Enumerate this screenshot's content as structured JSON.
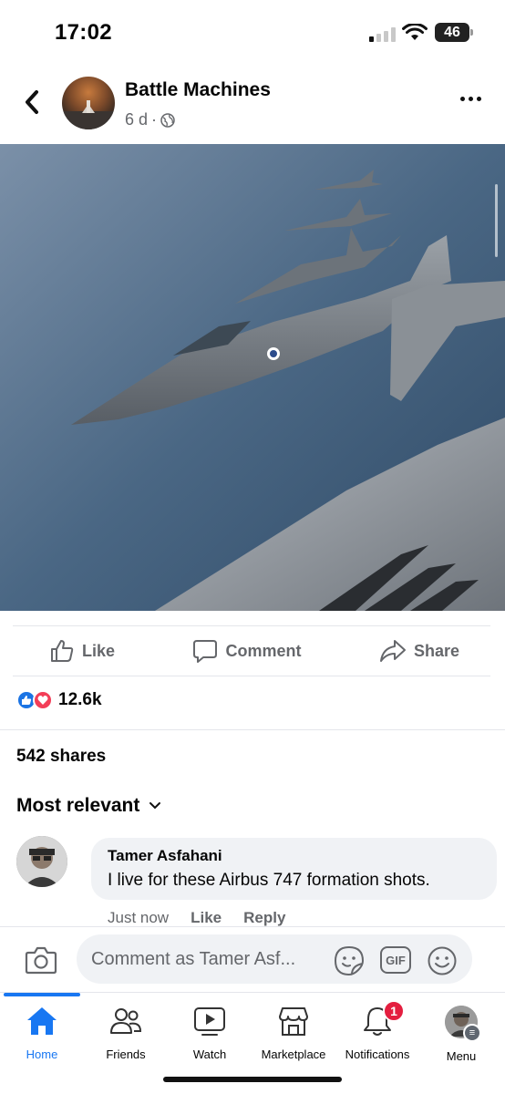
{
  "status_bar": {
    "time": "17:02",
    "battery": "46"
  },
  "header": {
    "page_name": "Battle Machines",
    "post_age": "6 d",
    "separator": "·"
  },
  "actions": {
    "like": "Like",
    "comment": "Comment",
    "share": "Share"
  },
  "reactions": {
    "count": "12.6k"
  },
  "shares": "542 shares",
  "sort_label": "Most relevant",
  "comment": {
    "author": "Tamer Asfahani",
    "text": "I live for these Airbus 747 formation shots.",
    "time": "Just now",
    "like": "Like",
    "reply": "Reply"
  },
  "composer": {
    "placeholder": "Comment as Tamer Asf...",
    "gif_label": "GIF"
  },
  "tabs": [
    {
      "label": "Home"
    },
    {
      "label": "Friends"
    },
    {
      "label": "Watch"
    },
    {
      "label": "Marketplace"
    },
    {
      "label": "Notifications",
      "badge": "1"
    },
    {
      "label": "Menu"
    }
  ],
  "colors": {
    "accent": "#1877f2",
    "like_blue": "#1b74e4",
    "love_red": "#f33e58",
    "badge_red": "#e41e3f",
    "muted": "#65676b",
    "bubble": "#f0f2f5"
  },
  "icons": [
    "back-icon",
    "globe-icon",
    "more-icon",
    "like-icon",
    "comment-icon",
    "share-icon",
    "camera-icon",
    "sticker-icon",
    "emoji-icon",
    "home-icon",
    "friends-icon",
    "watch-icon",
    "marketplace-icon",
    "bell-icon",
    "chevron-down-icon"
  ]
}
